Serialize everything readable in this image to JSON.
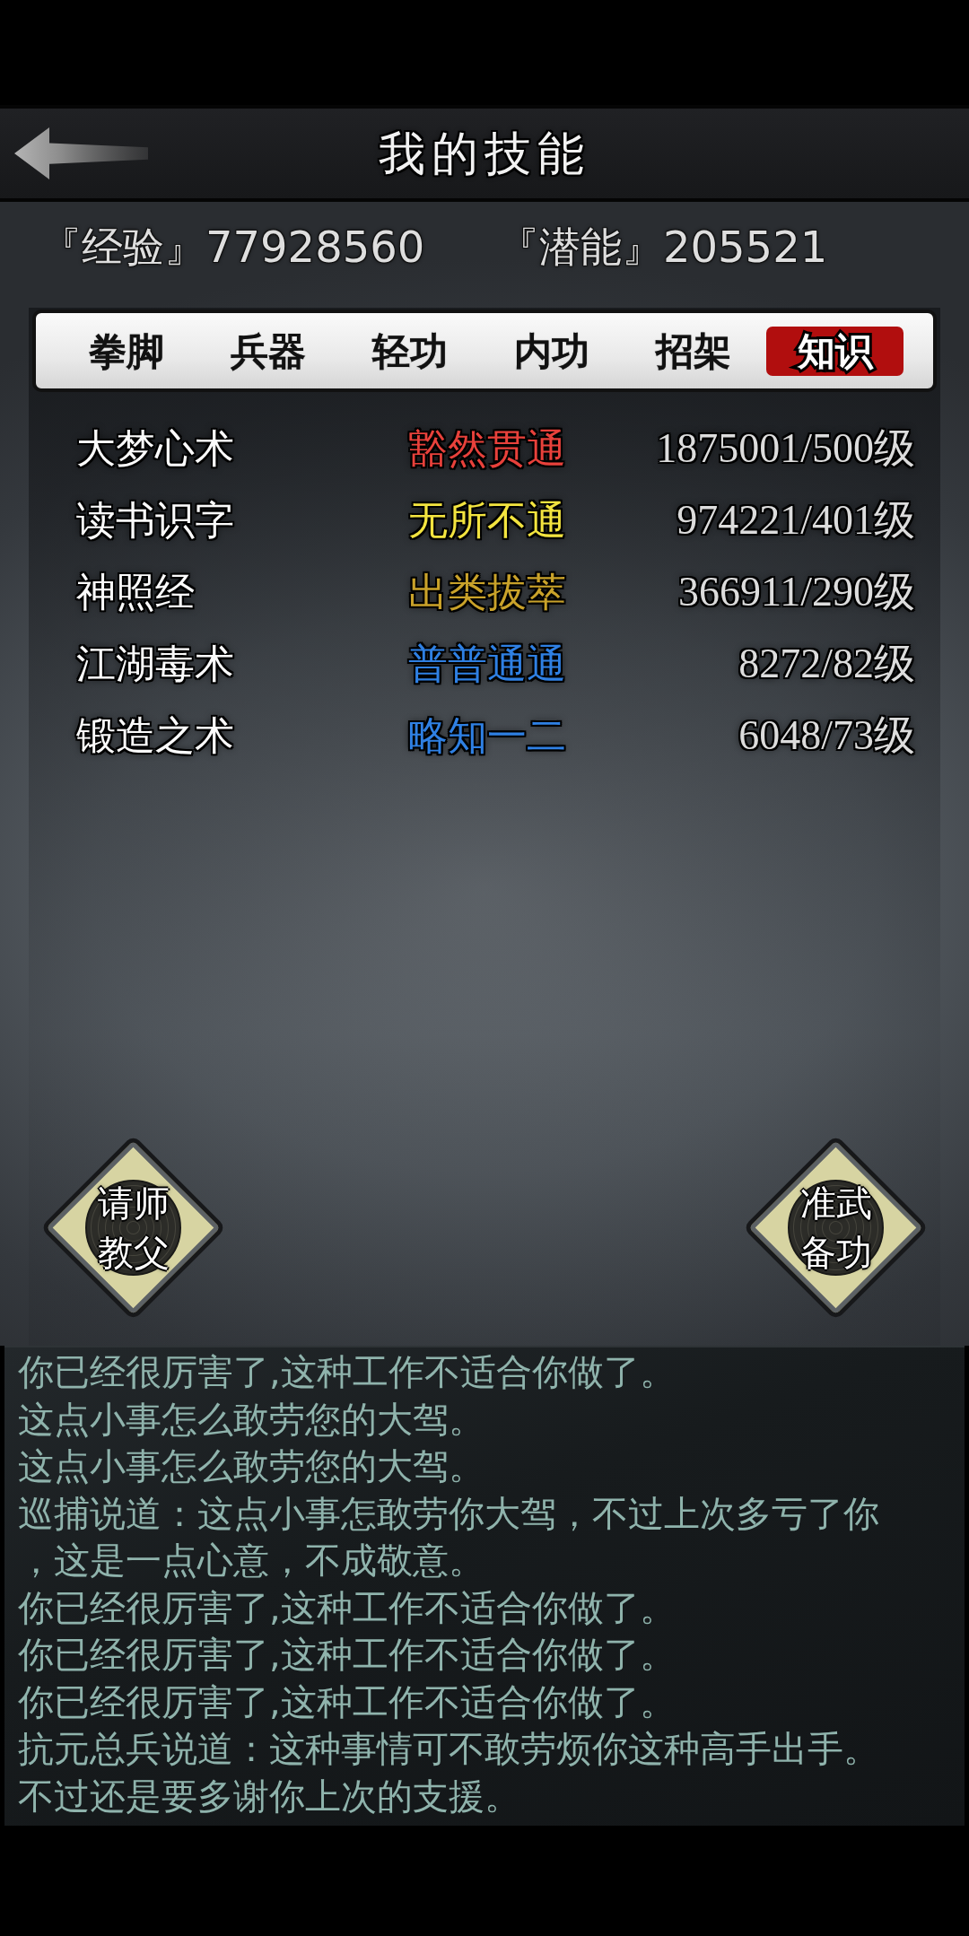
{
  "header": {
    "title": "我的技能"
  },
  "stats": [
    {
      "label": "『经验』",
      "value": "77928560"
    },
    {
      "label": "『潜能』",
      "value": "205521"
    }
  ],
  "tabs": [
    {
      "label": "拳脚",
      "selected": false
    },
    {
      "label": "兵器",
      "selected": false
    },
    {
      "label": "轻功",
      "selected": false
    },
    {
      "label": "内功",
      "selected": false
    },
    {
      "label": "招架",
      "selected": false
    },
    {
      "label": "知识",
      "selected": true
    }
  ],
  "skills": [
    {
      "name": "大梦心术",
      "rank": "豁然贯通",
      "color": "#e8413b",
      "points": "1875001",
      "grade": "/500级"
    },
    {
      "name": "读书识字",
      "rank": "无所不通",
      "color": "#f3e43f",
      "points": "974221",
      "grade": "/401级"
    },
    {
      "name": "神照经",
      "rank": "出类拔萃",
      "color": "#c9a22a",
      "points": "366911",
      "grade": "/290级"
    },
    {
      "name": "江湖毒术",
      "rank": "普普通通",
      "color": "#2f80e3",
      "points": "8272",
      "grade": "/82级"
    },
    {
      "name": "锻造之术",
      "rank": "略知一二",
      "color": "#2f80e3",
      "points": "6048",
      "grade": "/73级"
    }
  ],
  "actions": [
    {
      "label": "请师教父"
    },
    {
      "label": "准武备功"
    }
  ],
  "log": [
    "你已经很厉害了,这种工作不适合你做了。",
    "这点小事怎么敢劳您的大驾。",
    "这点小事怎么敢劳您的大驾。",
    "巡捕说道：这点小事怎敢劳你大驾，不过上次多亏了你，这是一点心意，不成敬意。",
    "你已经很厉害了,这种工作不适合你做了。",
    "你已经很厉害了,这种工作不适合你做了。",
    "你已经很厉害了,这种工作不适合你做了。",
    "抗元总兵说道：这种事情可不敢劳烦你这种高手出手。",
    "不过还是要多谢你上次的支援。"
  ]
}
